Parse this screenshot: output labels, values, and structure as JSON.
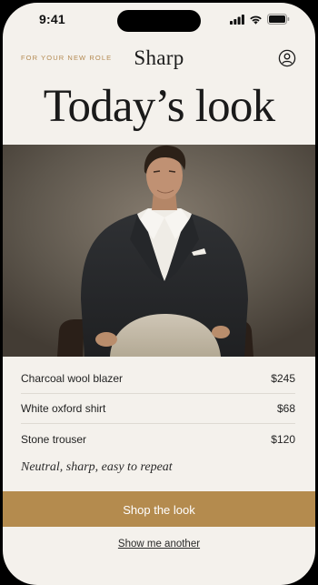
{
  "status_bar": {
    "time": "9:41",
    "icons": [
      "signal-icon",
      "wifi-icon",
      "battery-icon"
    ]
  },
  "header": {
    "tagline": "FOR YOUR NEW ROLE",
    "brand": "Sharp",
    "profile_icon": "user-circle-icon"
  },
  "title": "Today’s look",
  "hero": {
    "image": "man-in-charcoal-blazer-seated-photo"
  },
  "items": [
    {
      "name": "Charcoal wool blazer",
      "price": "$245"
    },
    {
      "name": "White oxford shirt",
      "price": "$68"
    },
    {
      "name": "Stone trouser",
      "price": "$120"
    }
  ],
  "note": "Neutral, sharp, easy to repeat",
  "actions": {
    "shop_label": "Shop the look",
    "another_label": "Show me another"
  },
  "colors": {
    "background": "#f4f1ec",
    "accent": "#b48b4e",
    "text": "#1a1a1a"
  }
}
